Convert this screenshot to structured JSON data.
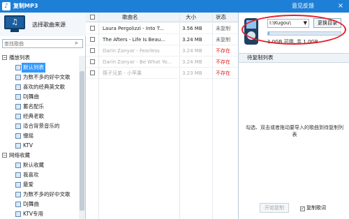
{
  "window": {
    "title": "复制MP3",
    "feedback": "意见反馈",
    "close": "×"
  },
  "source": {
    "title": "选择歌曲来源",
    "search_placeholder": "查找歌曲",
    "groups": [
      {
        "label": "播放列表",
        "toggle": "−",
        "items": [
          "默认列表",
          "为数不多的好中文歌",
          "喜欢的经典英文歌",
          "DJ舞曲",
          "蓄名配乐",
          "经典老歌",
          "适合背景音乐的",
          "慢摇",
          "KTV"
        ]
      },
      {
        "label": "网络收藏",
        "toggle": "−",
        "items": [
          "默认收藏",
          "我喜欢",
          "最爱",
          "为数不多的好中文歌",
          "DJ舞曲",
          "KTV专用"
        ]
      }
    ],
    "selected_item": "默认列表"
  },
  "songs": {
    "columns": {
      "name": "歌曲名",
      "size": "大小",
      "status": "状态"
    },
    "rows": [
      {
        "name": "Laura Pergolizzi - Into T...",
        "size": "3.56 MB",
        "status": "未复制",
        "missing": false
      },
      {
        "name": "The Afters - Life Is Beau...",
        "size": "3.24 MB",
        "status": "未复制",
        "missing": false
      },
      {
        "name": "Darin Zanyar - Fearless",
        "size": "3.24 MB",
        "status": "不存在",
        "missing": true
      },
      {
        "name": "Darin Zanyar - Be What Yo...",
        "size": "3.24 MB",
        "status": "不存在",
        "missing": true
      },
      {
        "name": "筷子兄弟 - 小苹果",
        "size": "3.23 MB",
        "status": "不存在",
        "missing": true
      }
    ]
  },
  "device": {
    "drive": "I:\\Kugou\\",
    "change_button": "更换目录",
    "capacity_text": "1.0GB 可用, 共 1.0GB",
    "used_fraction": 0.02,
    "pending_title": "待复制列表",
    "hint": "勾选、双击或者拖动要导入的歌曲到待复制列表",
    "start_button": "开始复制",
    "copy_lyrics_label": "复制歌词",
    "copy_lyrics_checked": true,
    "check_mark": "✓"
  },
  "colors": {
    "titlebar": "#1e7fd6",
    "missing": "#e02020",
    "selected": "#3399ff",
    "annotation": "#e5202a"
  }
}
